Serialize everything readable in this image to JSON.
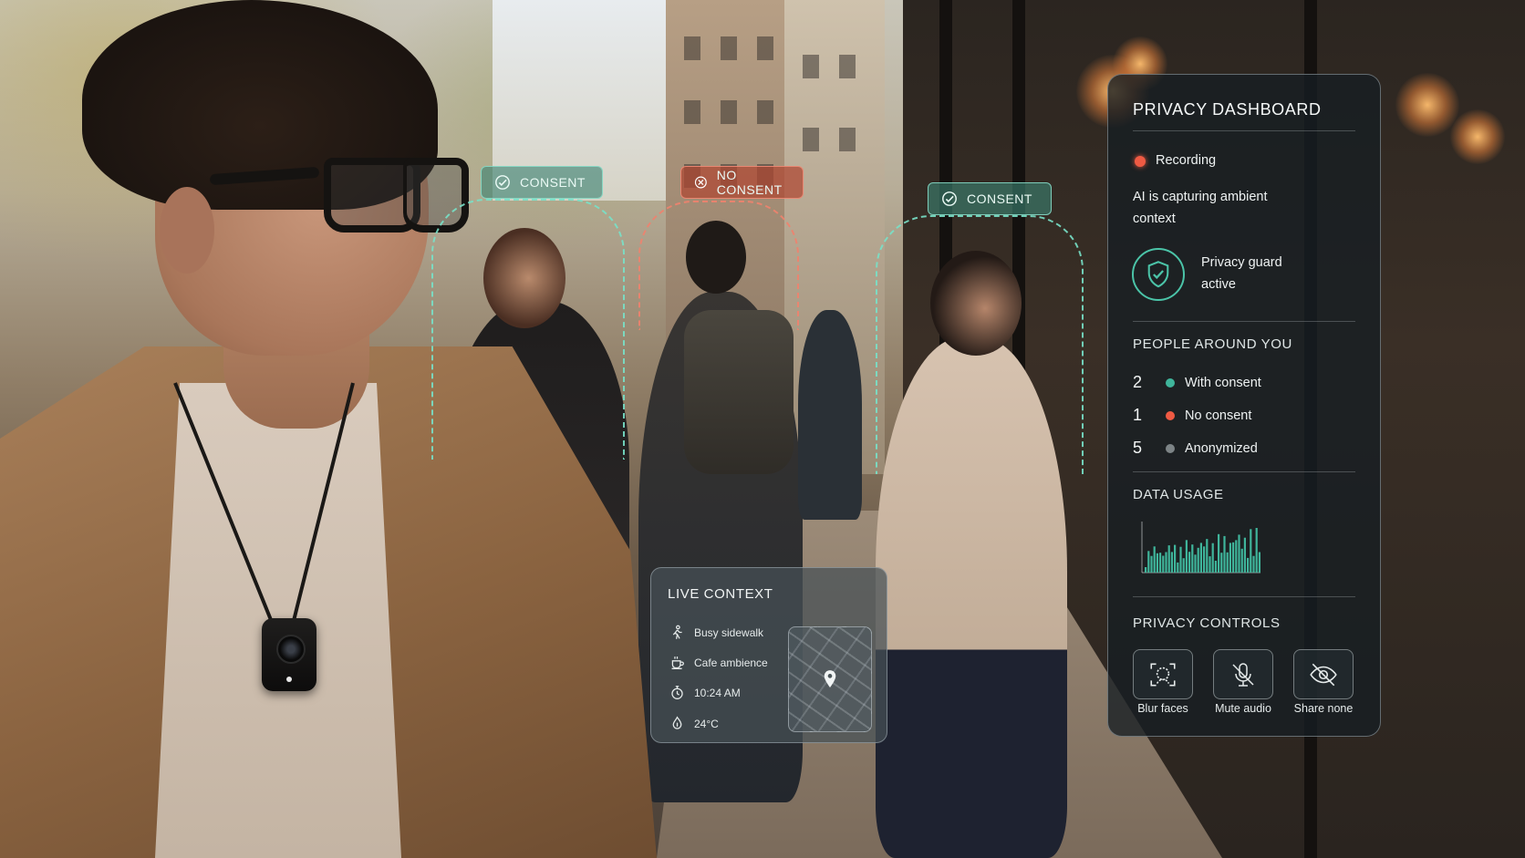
{
  "tags": [
    {
      "label": "CONSENT",
      "status": "consent"
    },
    {
      "label": "NO CONSENT",
      "status": "no-consent"
    },
    {
      "label": "CONSENT",
      "status": "consent"
    }
  ],
  "live_context": {
    "title": "LIVE CONTEXT",
    "items": [
      {
        "icon": "walking-person-icon",
        "label": "Busy sidewalk"
      },
      {
        "icon": "coffee-cup-icon",
        "label": "Cafe ambience"
      },
      {
        "icon": "stopwatch-icon",
        "label": "10:24 AM"
      },
      {
        "icon": "temperature-icon",
        "label": "24°C"
      }
    ],
    "map_icon": "map-pin-icon"
  },
  "dashboard": {
    "title": "PRIVACY DASHBOARD",
    "status": "Recording",
    "status_detail": "AI is capturing ambient context",
    "guard": "Privacy guard active",
    "people_header": "PEOPLE AROUND YOU",
    "people": [
      {
        "count": "2",
        "label": "With consent",
        "color": "#3fb59b"
      },
      {
        "count": "1",
        "label": "No consent",
        "color": "#ef5a43"
      },
      {
        "count": "5",
        "label": "Anonymized",
        "color": "#7d8486"
      }
    ],
    "data_usage_header": "DATA USAGE",
    "controls_header": "PRIVACY CONTROLS",
    "controls": [
      {
        "icon": "face-scan-icon",
        "label": "Blur faces"
      },
      {
        "icon": "mute-microphone-icon",
        "label": "Mute audio"
      },
      {
        "icon": "eye-slash-icon",
        "label": "Share none"
      }
    ]
  },
  "colors": {
    "consent": "#3fb59b",
    "no_consent": "#ef5a43",
    "panel": "#161e22"
  }
}
